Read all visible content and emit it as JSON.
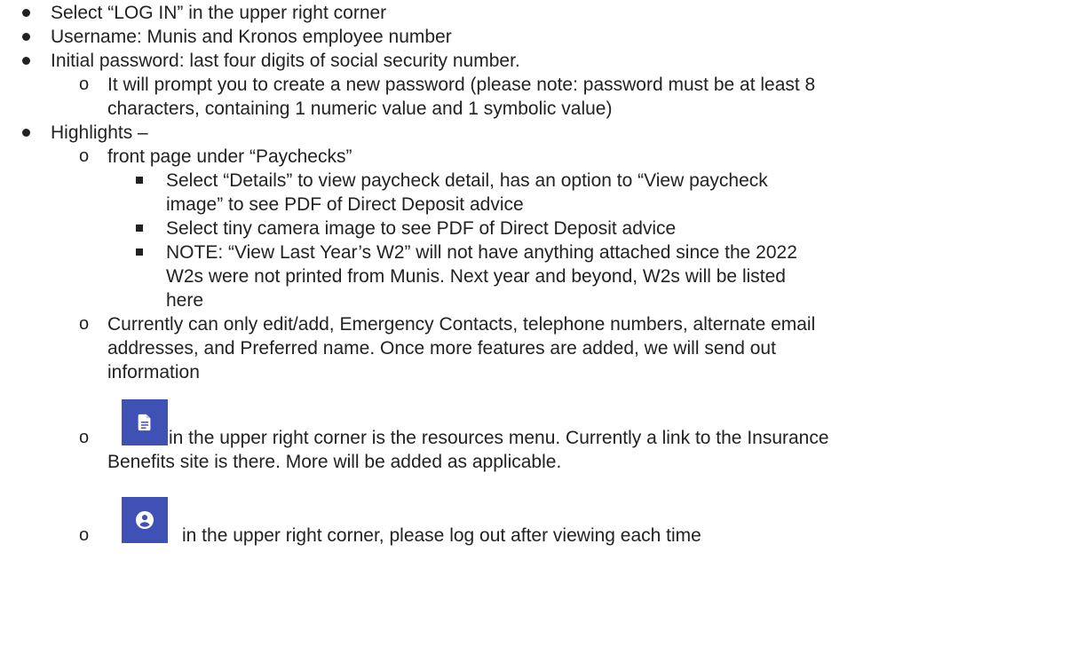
{
  "bullets": [
    {
      "text": "Select “LOG IN” in the upper right corner"
    },
    {
      "text": "Username: Munis and Kronos employee number"
    },
    {
      "text": "Initial password: last four digits of social security number."
    },
    {
      "text": "Highlights –"
    }
  ],
  "password_sub": {
    "line1": "It will prompt you to create a new password (please note: password must be at least 8",
    "line2": "characters, containing 1 numeric value and 1 symbolic value)"
  },
  "highlights": {
    "front_page": "front page under “Paychecks”",
    "details": {
      "line1": "Select “Details” to view paycheck detail, has an option to “View paycheck",
      "line2": "image” to see PDF of Direct Deposit advice"
    },
    "camera": "Select tiny camera image to see PDF of Direct Deposit advice",
    "note": {
      "line1": "NOTE: “View Last Year’s W2” will not have anything attached since the 2022",
      "line2": "W2s were not printed from Munis. Next year and beyond, W2s will be listed",
      "line3": "here"
    },
    "edit": {
      "line1": "Currently can only edit/add, Emergency Contacts, telephone numbers, alternate email",
      "line2": "addresses, and Preferred name. Once more features are added, we will send out",
      "line3": "information"
    },
    "resources": {
      "line1": "in the upper right corner is the resources menu. Currently a link to the Insurance",
      "line2": "Benefits site is there. More will be added as applicable.",
      "icon": "document-icon"
    },
    "logout": {
      "line1": "in the upper right corner, please log out after viewing each time",
      "icon": "account-circle-icon"
    }
  },
  "colors": {
    "icon_tile": "#3f51b5",
    "text": "#222222"
  }
}
